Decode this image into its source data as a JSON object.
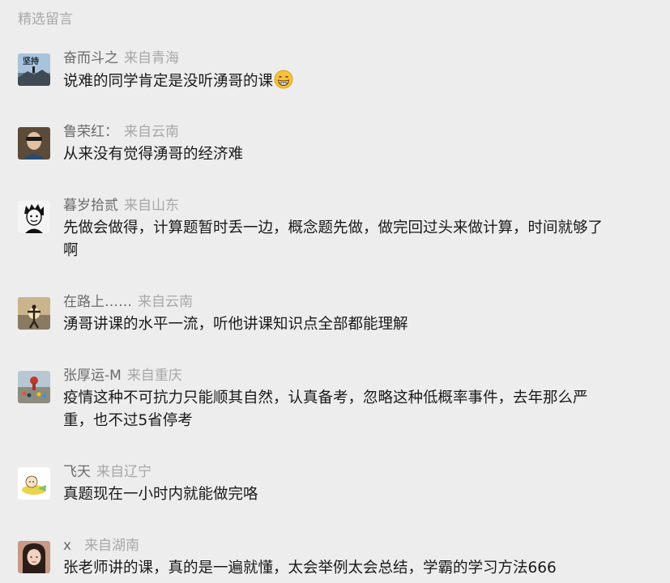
{
  "section_title": "精选留言",
  "comments": [
    {
      "name": "奋而斗之",
      "location": "来自青海",
      "lines": [
        "说难的同学肯定是没听湧哥的课"
      ],
      "emoji": "grinning-face-icon",
      "avatar_text": "坚持"
    },
    {
      "name": "鲁荣红：",
      "location": "来自云南",
      "lines": [
        "从来没有觉得湧哥的经济难"
      ]
    },
    {
      "name": "暮岁拾贰",
      "location": "来自山东",
      "lines": [
        "先做会做得，计算题暂时丢一边，概念题先做，做完回过头来做计算，时间就够了",
        "啊"
      ]
    },
    {
      "name": "在路上……",
      "location": "来自云南",
      "lines": [
        "湧哥讲课的水平一流，听他讲课知识点全部都能理解"
      ]
    },
    {
      "name": "张厚运-M",
      "location": "来自重庆",
      "lines": [
        "疫情这种不可抗力只能顺其自然，认真备考，忽略这种低概率事件，去年那么严",
        "重，也不过5省停考"
      ]
    },
    {
      "name": "飞天",
      "location": "来自辽宁",
      "lines": [
        "真题现在一小时内就能做完咯"
      ]
    },
    {
      "name": "x",
      "location": "来自湖南",
      "lines": [
        "张老师讲的课，真的是一遍就懂，太会举例太会总结，学霸的学习方法666"
      ]
    }
  ]
}
